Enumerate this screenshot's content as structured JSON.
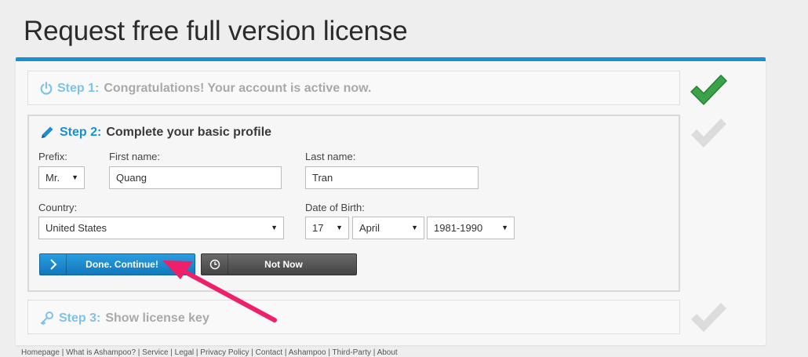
{
  "page": {
    "title": "Request free full version license"
  },
  "steps": [
    {
      "number": "Step 1:",
      "text": "Congratulations! Your account is active now.",
      "status": "done"
    },
    {
      "number": "Step 2:",
      "text": "Complete your basic profile",
      "status": "active"
    },
    {
      "number": "Step 3:",
      "text": "Show license key",
      "status": "pending"
    }
  ],
  "form": {
    "prefix_label": "Prefix:",
    "prefix_value": "Mr.",
    "first_name_label": "First name:",
    "first_name_value": "Quang",
    "last_name_label": "Last name:",
    "last_name_value": "Tran",
    "country_label": "Country:",
    "country_value": "United States",
    "dob_label": "Date of Birth:",
    "dob_day": "17",
    "dob_month": "April",
    "dob_year": "1981-1990"
  },
  "buttons": {
    "continue_label": "Done. Continue!",
    "not_now_label": "Not Now"
  },
  "footer": {
    "links_text": "Homepage | What is Ashampoo? | Service | Legal | Privacy Policy | Contact | Ashampoo | Third-Party | About"
  },
  "colors": {
    "accent": "#1a8fd1",
    "check_done": "#3aa34a",
    "check_pending": "#dcdcdc",
    "annotation_arrow": "#ef1f6a"
  },
  "icons": {
    "step1": "power-icon",
    "step2": "pencil-icon",
    "step3": "key-icon",
    "continue": "chevron-right-icon",
    "not_now": "clock-icon"
  }
}
